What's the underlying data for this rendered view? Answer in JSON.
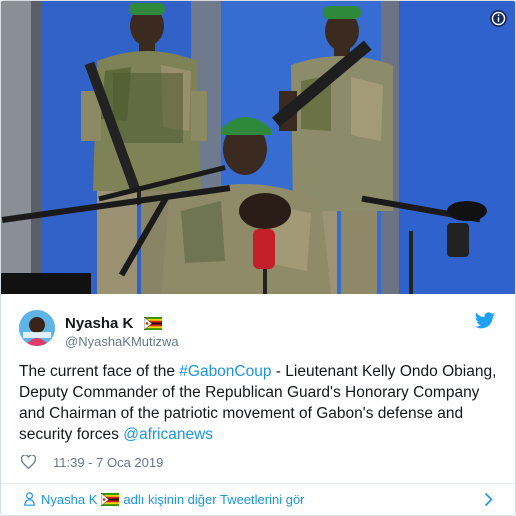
{
  "media": {
    "description_icon": "info-icon"
  },
  "author": {
    "name": "Nyasha K",
    "handle": "@NyashaKMutizwa",
    "flag": "zimbabwe-flag",
    "platform_icon": "twitter-bird-icon"
  },
  "tweet": {
    "text_before": "The current face of the ",
    "hashtag": "#GabonCoup",
    "text_middle": " - Lieutenant Kelly Ondo Obiang, Deputy Commander of the Republican Guard's Honorary Company and Chairman of the patriotic movement of Gabon's defense and security forces ",
    "mention": "@africanews"
  },
  "meta": {
    "like_icon": "heart-icon",
    "timestamp": "11:39 - 7 Oca 2019"
  },
  "footer": {
    "prefix": "Nyasha K",
    "suffix": "adlı kişinin diğer Tweetlerini gör"
  },
  "colors": {
    "link": "#1b95e0",
    "text": "#14171a",
    "secondary": "#657786",
    "wall_blue": "#2f63c8"
  }
}
